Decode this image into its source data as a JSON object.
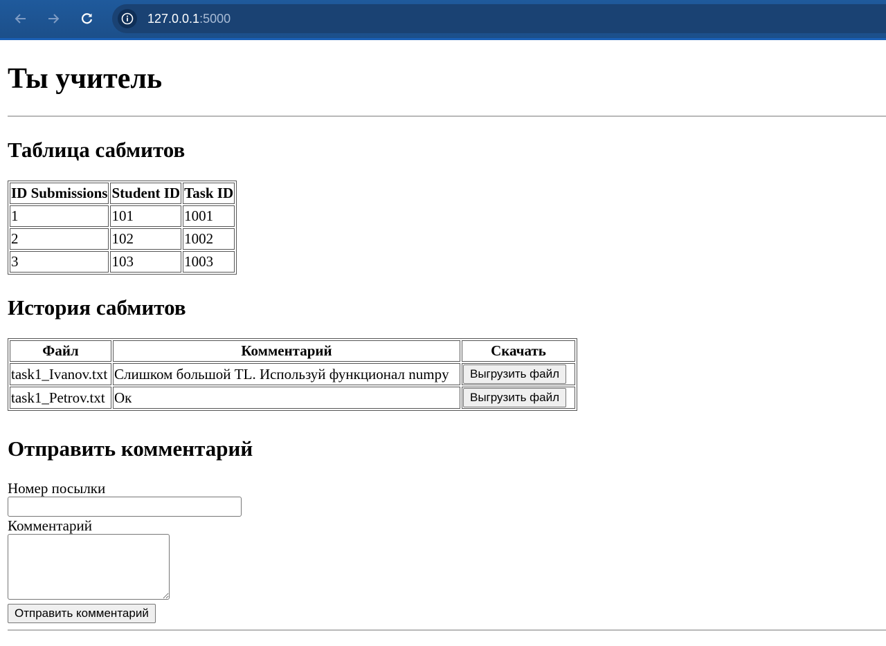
{
  "browser": {
    "url_host": "127.0.0.1",
    "url_port": ":5000"
  },
  "page": {
    "title": "Ты учитель",
    "submissions_heading": "Таблица сабмитов",
    "submissions_table": {
      "headers": [
        "ID Submissions",
        "Student ID",
        "Task ID"
      ],
      "rows": [
        [
          "1",
          "101",
          "1001"
        ],
        [
          "2",
          "102",
          "1002"
        ],
        [
          "3",
          "103",
          "1003"
        ]
      ]
    },
    "history_heading": "История сабмитов",
    "history_table": {
      "headers": [
        "Файл",
        "Комментарий",
        "Скачать"
      ],
      "rows": [
        {
          "file": "task1_Ivanov.txt",
          "comment": "Слишком большой TL. Используй функционал numpy",
          "button": "Выгрузить файл"
        },
        {
          "file": "task1_Petrov.txt",
          "comment": "Ок",
          "button": "Выгрузить файл"
        }
      ]
    },
    "comment_heading": "Отправить комментарий",
    "form": {
      "submission_number_label": "Номер посылки",
      "submission_number_value": "",
      "comment_label": "Комментарий",
      "comment_value": "",
      "submit_label": "Отправить комментарий"
    }
  }
}
